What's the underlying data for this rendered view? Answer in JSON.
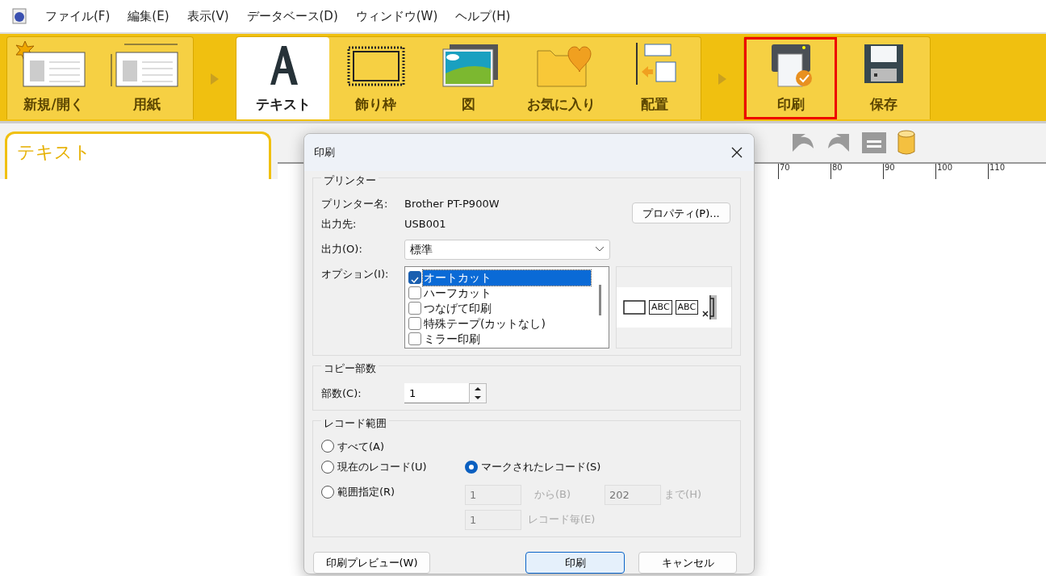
{
  "menu": [
    "ファイル(F)",
    "編集(E)",
    "表示(V)",
    "データベース(D)",
    "ウィンドウ(W)",
    "ヘルプ(H)"
  ],
  "ribbon": {
    "groups": [
      {
        "items": [
          {
            "label": "新規/開く",
            "selected": false,
            "highlighted": false
          },
          {
            "label": "用紙",
            "selected": false,
            "highlighted": false
          }
        ]
      },
      {
        "items": [
          {
            "label": "テキスト",
            "selected": true,
            "highlighted": false
          },
          {
            "label": "飾り枠",
            "selected": false,
            "highlighted": false
          },
          {
            "label": "図",
            "selected": false,
            "highlighted": false
          },
          {
            "label": "お気に入り",
            "selected": false,
            "highlighted": false
          },
          {
            "label": "配置",
            "selected": false,
            "highlighted": false
          }
        ]
      },
      {
        "items": [
          {
            "label": "印刷",
            "selected": false,
            "highlighted": true
          },
          {
            "label": "保存",
            "selected": false,
            "highlighted": false
          }
        ]
      }
    ]
  },
  "sidebar": {
    "title": "テキスト"
  },
  "ruler": [
    "70",
    "80",
    "90",
    "100",
    "110"
  ],
  "dialog": {
    "title": "印刷",
    "printer": {
      "legend": "プリンター",
      "fields": [
        {
          "label": "プリンター名:",
          "value": "Brother PT-P900W"
        },
        {
          "label": "出力先:",
          "value": "USB001"
        }
      ],
      "properties_button": "プロパティ(P)...",
      "output_label": "出力(O):",
      "output_value": "標準",
      "options_label": "オプション(I):",
      "options": [
        {
          "label": "オートカット",
          "checked": true,
          "selected": true
        },
        {
          "label": "ハーフカット",
          "checked": false,
          "selected": false
        },
        {
          "label": "つなげて印刷",
          "checked": false,
          "selected": false
        },
        {
          "label": "特殊テープ(カットなし)",
          "checked": false,
          "selected": false
        },
        {
          "label": "ミラー印刷",
          "checked": false,
          "selected": false
        }
      ],
      "preview_labels": [
        "ABC",
        "ABC"
      ]
    },
    "copies": {
      "legend": "コピー部数",
      "label": "部数(C):",
      "value": "1"
    },
    "records": {
      "legend": "レコード範囲",
      "radios": [
        {
          "label": "すべて(A)",
          "selected": false
        },
        {
          "label": "現在のレコード(U)",
          "selected": false
        },
        {
          "label": "マークされたレコード(S)",
          "selected": true
        },
        {
          "label": "範囲指定(R)",
          "selected": false
        }
      ],
      "from_value": "1",
      "from_label": "から(B)",
      "to_value": "202",
      "to_label": "まで(H)",
      "every_value": "1",
      "every_label": "レコード毎(E)",
      "disabled": true
    },
    "buttons": [
      {
        "label": "印刷プレビュー(W)",
        "default": false
      },
      {
        "label": "印刷",
        "default": true
      },
      {
        "label": "キャンセル",
        "default": false
      }
    ]
  }
}
